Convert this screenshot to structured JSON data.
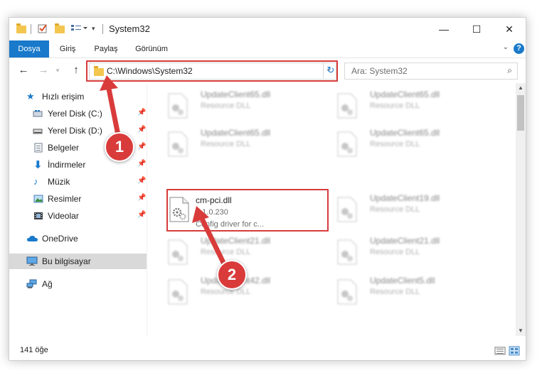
{
  "window": {
    "title": "System32",
    "minimize_icon": "minimize-icon",
    "maximize_icon": "maximize-icon",
    "close_icon": "close-icon"
  },
  "ribbon": {
    "tabs": [
      {
        "label": "Dosya"
      },
      {
        "label": "Giriş"
      },
      {
        "label": "Paylaş"
      },
      {
        "label": "Görünüm"
      }
    ],
    "help_label": "?"
  },
  "address": {
    "path": "C:\\Windows\\System32",
    "search_placeholder": "Ara: System32"
  },
  "sidebar": {
    "items": [
      {
        "label": "Hızlı erişim",
        "icon": "star-icon"
      },
      {
        "label": "Yerel Disk (C:)",
        "icon": "drive-icon",
        "pinned": true
      },
      {
        "label": "Yerel Disk (D:)",
        "icon": "drive-icon",
        "pinned": true
      },
      {
        "label": "Belgeler",
        "icon": "documents-icon",
        "pinned": true
      },
      {
        "label": "İndirmeler",
        "icon": "download-icon",
        "pinned": true
      },
      {
        "label": "Müzik",
        "icon": "music-icon",
        "pinned": true
      },
      {
        "label": "Resimler",
        "icon": "pictures-icon",
        "pinned": true
      },
      {
        "label": "Videolar",
        "icon": "videos-icon",
        "pinned": true
      },
      {
        "label": "OneDrive",
        "icon": "cloud-icon"
      },
      {
        "label": "Bu bilgisayar",
        "icon": "computer-icon",
        "selected": true
      },
      {
        "label": "Ağ",
        "icon": "network-icon"
      }
    ]
  },
  "files": {
    "highlighted": {
      "name": "cm-pci.dll",
      "version": "4.1.0.230",
      "description": "Config driver for c..."
    },
    "blurred": [
      {
        "name": "UpdateClient65.dll",
        "description": "Resource DLL"
      },
      {
        "name": "UpdateClient65.dll",
        "description": "Resource DLL"
      },
      {
        "name": "UpdateClient65.dll",
        "description": "Resource DLL"
      },
      {
        "name": "UpdateClient65.dll",
        "description": "Resource DLL"
      },
      {
        "name": "UpdateClient19.dll",
        "description": "Resource DLL"
      },
      {
        "name": "UpdateClient21.dll",
        "description": "Resource DLL"
      },
      {
        "name": "UpdateClient21.dll",
        "description": "Resource DLL"
      },
      {
        "name": "UpdateClient42.dll",
        "description": "Resource DLL"
      },
      {
        "name": "UpdateClient5.dll",
        "description": "Resource DLL"
      }
    ]
  },
  "status": {
    "count": "141 öğe"
  },
  "callouts": [
    "1",
    "2"
  ],
  "colors": {
    "accent": "#1979ca",
    "highlight": "#d83b3b"
  }
}
